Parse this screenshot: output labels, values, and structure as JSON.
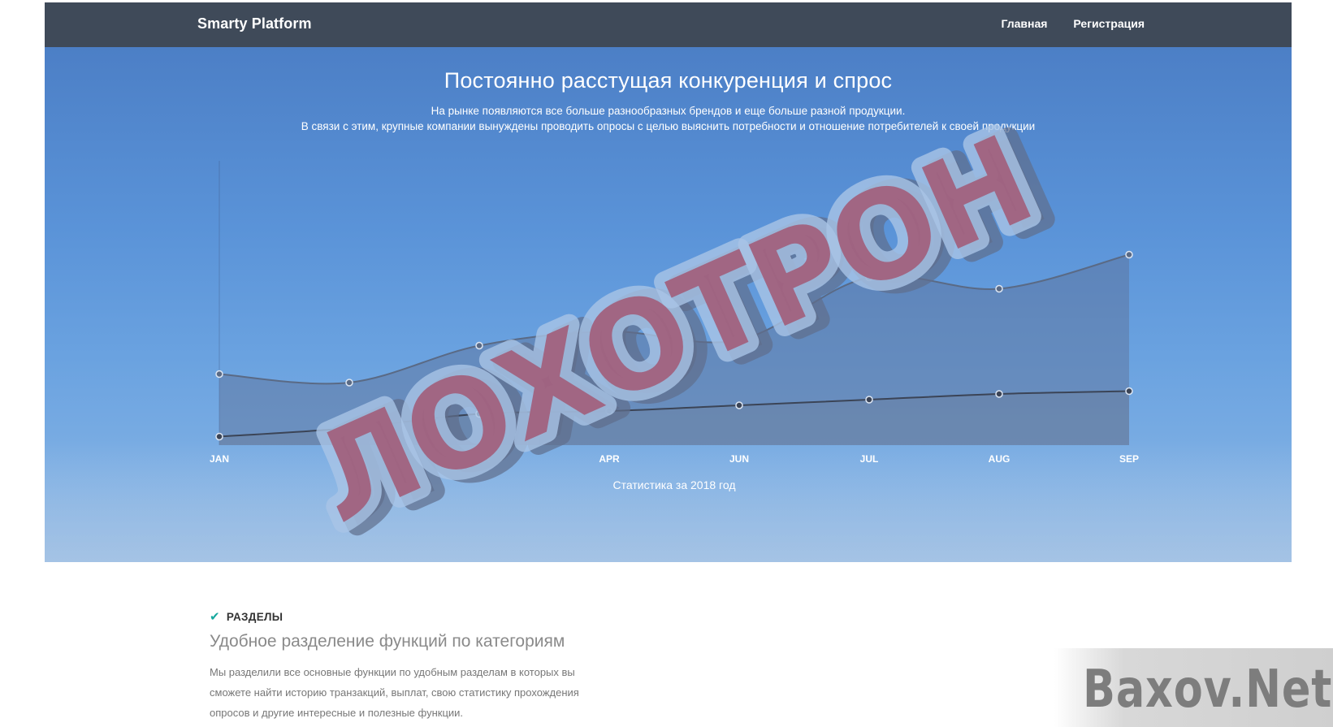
{
  "navbar": {
    "brand": "Smarty Platform",
    "links": [
      "Главная",
      "Регистрация"
    ]
  },
  "hero": {
    "title": "Постоянно расстущая конкуренция и спрос",
    "subtitle_line1": "На рынке появляются все больше разнообразных брендов и еще больше разной продукции.",
    "subtitle_line2": "В связи с этим, крупные компании вынуждены проводить опросы с целью выяснить потребности и отношение потребителей к своей продукции"
  },
  "chart_data": {
    "type": "area",
    "title": "",
    "caption": "Статистика за 2018 год",
    "xlabel": "",
    "ylabel": "",
    "categories": [
      "JAN",
      "FEB",
      "MAR",
      "APR",
      "JUN",
      "JUL",
      "AUG",
      "SEP"
    ],
    "y_axis_labels_shown": false,
    "ylim": [
      0,
      100
    ],
    "grid": false,
    "legend": "none",
    "series": [
      {
        "values": [
          25,
          22,
          35,
          40,
          37,
          59,
          55,
          67
        ],
        "line_color": "#5a6a85",
        "fill_color": "#5d6f95"
      },
      {
        "values": [
          3,
          6,
          11,
          12,
          14,
          16,
          18,
          19
        ],
        "line_color": "#3b4456",
        "fill_color": "#6a7a95"
      }
    ]
  },
  "overlay_stamp": {
    "text": "ЛОХОТРОН"
  },
  "section": {
    "tag": "РАЗДЕЛЫ",
    "title": "Удобное разделение функций по категориям",
    "text": "Мы разделили все основные функции по удобным разделам в которых вы сможете найти историю транзакций, выплат, свою статистику прохождения опросов и другие интересные и полезные функции."
  },
  "watermark": {
    "text": "Baxov.Net"
  },
  "colors": {
    "navbar_bg": "#3f4a59",
    "hero_top": "#4c7fc6",
    "hero_bottom": "#8cb7e2",
    "accent_check": "#16a89e",
    "stamp_fill": "#a0526e",
    "stamp_outline": "#a9c4e6",
    "stamp_shadow": "#5f6e8c"
  }
}
